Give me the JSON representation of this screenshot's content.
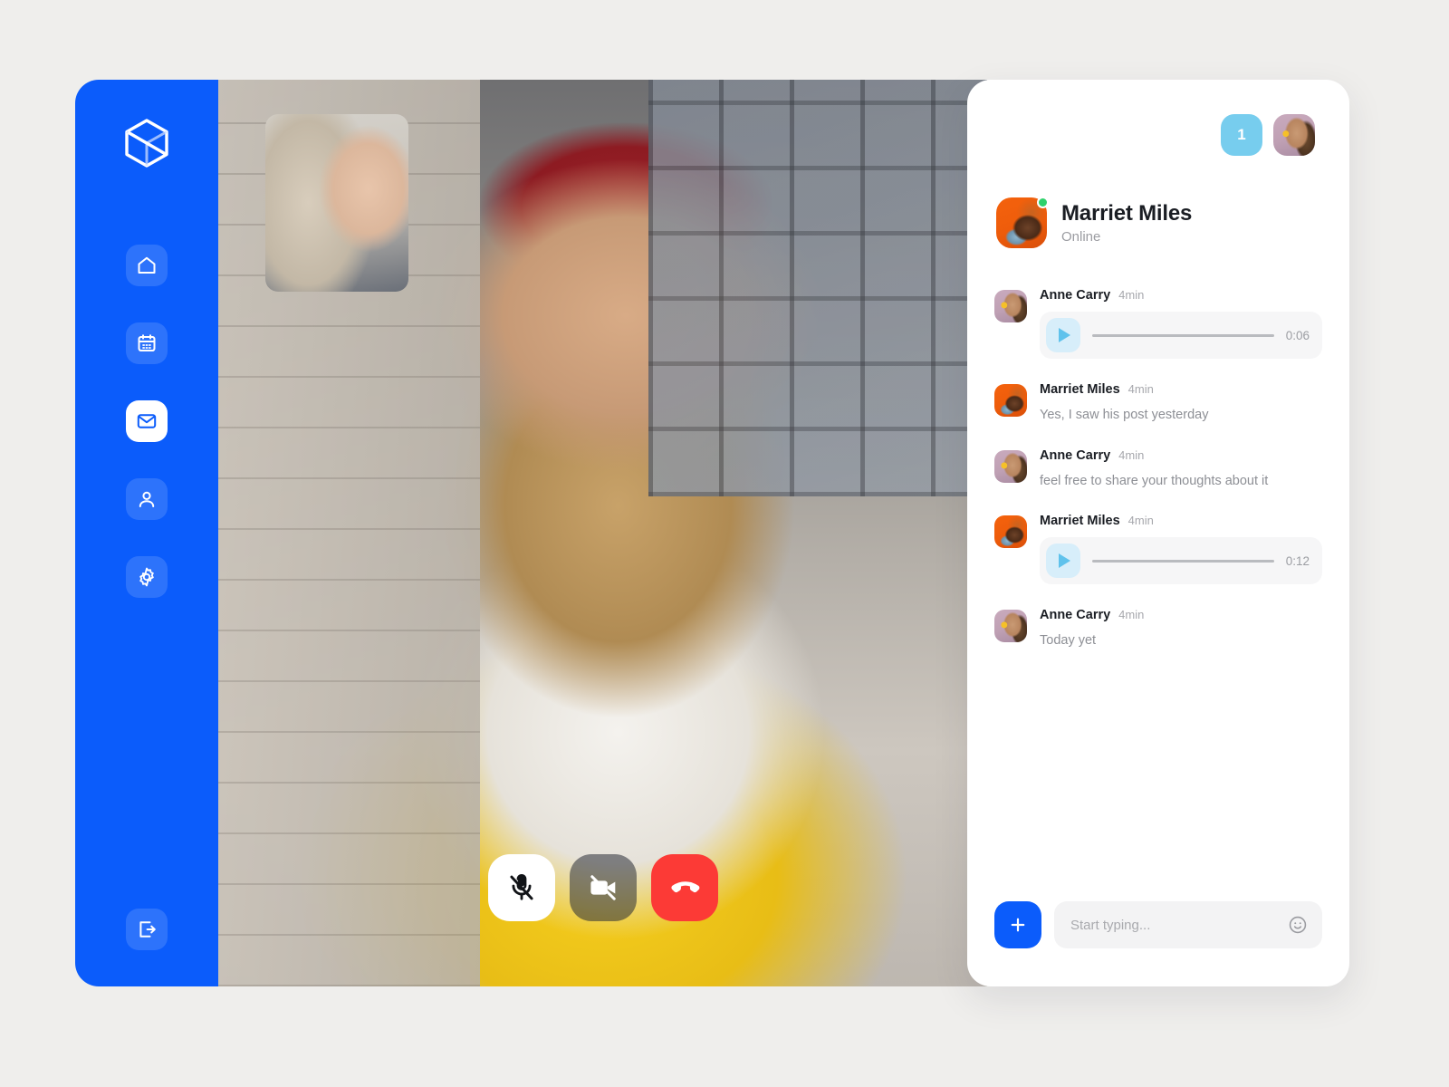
{
  "colors": {
    "brand_blue": "#0b5cfb",
    "page_background": "#efeeec",
    "badge_blue": "#77cdee",
    "hangup_red": "#fc3a36",
    "online_green": "#2ed16b",
    "play_button_blue": "#5fc2ec"
  },
  "sidebar": {
    "logo_icon": "cube-logo-icon",
    "items": [
      {
        "icon": "home-icon",
        "name": "home",
        "active": false
      },
      {
        "icon": "calendar-icon",
        "name": "calendar",
        "active": false
      },
      {
        "icon": "mail-icon",
        "name": "mail",
        "active": true
      },
      {
        "icon": "person-icon",
        "name": "contacts",
        "active": false
      },
      {
        "icon": "gear-icon",
        "name": "settings",
        "active": false
      }
    ],
    "logout_icon": "logout-icon"
  },
  "video_call": {
    "pip_label": "self-view-thumbnail",
    "controls": [
      {
        "name": "microphone-mute-button",
        "icon": "mic-off-icon",
        "state": "muted"
      },
      {
        "name": "camera-off-button",
        "icon": "video-off-icon",
        "state": "off"
      },
      {
        "name": "end-call-button",
        "icon": "phone-hangup-icon",
        "state": "active"
      }
    ]
  },
  "chat": {
    "notification_count": "1",
    "account_avatar": "anne-carry-avatar",
    "contact": {
      "name": "Marriet Miles",
      "status": "Online",
      "avatar": "marriet-miles-avatar"
    },
    "messages": [
      {
        "sender": "Anne Carry",
        "time": "4min",
        "avatar": "anne",
        "type": "audio",
        "duration": "0:06"
      },
      {
        "sender": "Marriet Miles",
        "time": "4min",
        "avatar": "marriet",
        "type": "text",
        "text": "Yes, I saw his post yesterday"
      },
      {
        "sender": "Anne Carry",
        "time": "4min",
        "avatar": "anne",
        "type": "text",
        "text": "feel free to share your thoughts about it"
      },
      {
        "sender": "Marriet Miles",
        "time": "4min",
        "avatar": "marriet",
        "type": "audio",
        "duration": "0:12"
      },
      {
        "sender": "Anne Carry",
        "time": "4min",
        "avatar": "anne",
        "type": "text",
        "text": "Today yet"
      }
    ],
    "composer": {
      "add_icon": "plus-icon",
      "placeholder": "Start typing...",
      "value": "",
      "emoji_icon": "smiley-icon"
    }
  }
}
